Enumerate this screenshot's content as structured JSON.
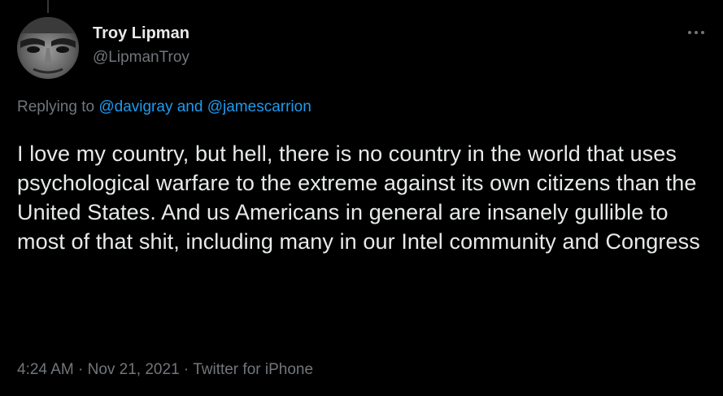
{
  "tweet": {
    "author_name": "Troy Lipman",
    "author_handle": "@LipmanTroy",
    "more_icon": "more-horizontal-icon",
    "replying_prefix": "Replying to",
    "reply_mention_1": "@davigray",
    "reply_joiner": "and",
    "reply_mention_2": "@jamescarrion",
    "text": "I love my country, but hell, there is no country in the world that uses psychological warfare to the extreme against its own citizens than the United States. And us Americans in general are insanely gullible to most of that shit, including many in our Intel community and Congress",
    "time": "4:24 AM",
    "separator": "·",
    "date": "Nov 21, 2021",
    "source": "Twitter for iPhone"
  },
  "colors": {
    "background": "#000000",
    "primary_text": "#e7e9ea",
    "secondary_text": "#71767b",
    "link": "#1d9bf0"
  }
}
